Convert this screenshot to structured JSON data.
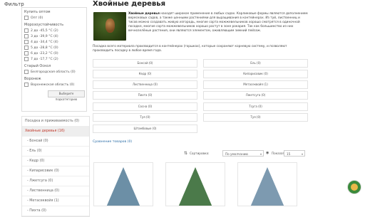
{
  "filter": {
    "title": "Фильтр",
    "groups": [
      {
        "title": "Купить оптом",
        "items": [
          "Опт (0)"
        ]
      },
      {
        "title": "Морозоустойчивость",
        "items": [
          "2 до -45,5 °С (2)",
          "3 до -39,9 °С (4)",
          "4 до -34,4 °С (4)",
          "5 до -28,8 °С (0)",
          "6 до -23,2 °С (0)",
          "7 до -17,7 °С (2)"
        ]
      },
      {
        "title": "Старый Оскол",
        "items": [
          "Белгородская область (0)"
        ]
      },
      {
        "title": "Воронеж",
        "items": [
          "Воронежская область (0)"
        ]
      }
    ],
    "apply_button": "Выберите подкатегорию"
  },
  "categories": [
    {
      "label": "Посадка и приживаемость (0)",
      "active": false,
      "sub": false
    },
    {
      "label": "Хвойные деревья (16)",
      "active": true,
      "sub": false
    },
    {
      "label": "- Бонсай (0)",
      "active": false,
      "sub": true
    },
    {
      "label": "- Ель (0)",
      "active": false,
      "sub": true
    },
    {
      "label": "- Кедр (0)",
      "active": false,
      "sub": true
    },
    {
      "label": "- Кипарисовик (0)",
      "active": false,
      "sub": true
    },
    {
      "label": "- Лжетсуга (0)",
      "active": false,
      "sub": true
    },
    {
      "label": "- Лиственница (0)",
      "active": false,
      "sub": true
    },
    {
      "label": "- Метасеквойя (1)",
      "active": false,
      "sub": true
    },
    {
      "label": "- Пихта (0)",
      "active": false,
      "sub": true
    }
  ],
  "main": {
    "title": "Хвойные деревья",
    "intro_bold": "Хвойные деревья",
    "intro_rest": " находят широкое применение в любых садах. Карликовые формы являются дополнением вересковых садов, а также ценными растениями для выращивания в контейнерах. Из туй, лиственниц и тисов можно создавать живую изгородь, многие сорта можжевельников хорошо смотрятся в одиночной посадке, многие сорта можжевельников хорошо растут в зоне рокария. Так как большинство из них вечнозелёные растения, они являются элементом, оживляющим зимний пейзаж.",
    "intro_2": "Посадка всего материала производится в контейнерах (горшках), которые сохраняют корневую систему, и позволяют производить посадку в любое время года.",
    "subcats": [
      "Бонсай (0)",
      "Ель (0)",
      "Кедр (0)",
      "Кипарисовик (0)",
      "Лиственница (0)",
      "Лжетсуга (0)",
      "Пихта (0)",
      "Метасеквойя (1)",
      "Сосна (0)",
      "Туя (0)",
      "Тсуга (0)",
      "Туя (0)",
      "Штамбовые (0)"
    ],
    "compare_link": "Сравнение товаров (0)",
    "sort_label": "Сортировка:",
    "sort_value": "По умолчанию",
    "show_label": "Показать:",
    "show_value": "15"
  },
  "icons": {
    "sort": "sort-icon",
    "eye": "eye-icon",
    "chat": "chat-icon"
  },
  "colors": {
    "active_category": "#c0392b",
    "link": "#2e6fa8"
  }
}
